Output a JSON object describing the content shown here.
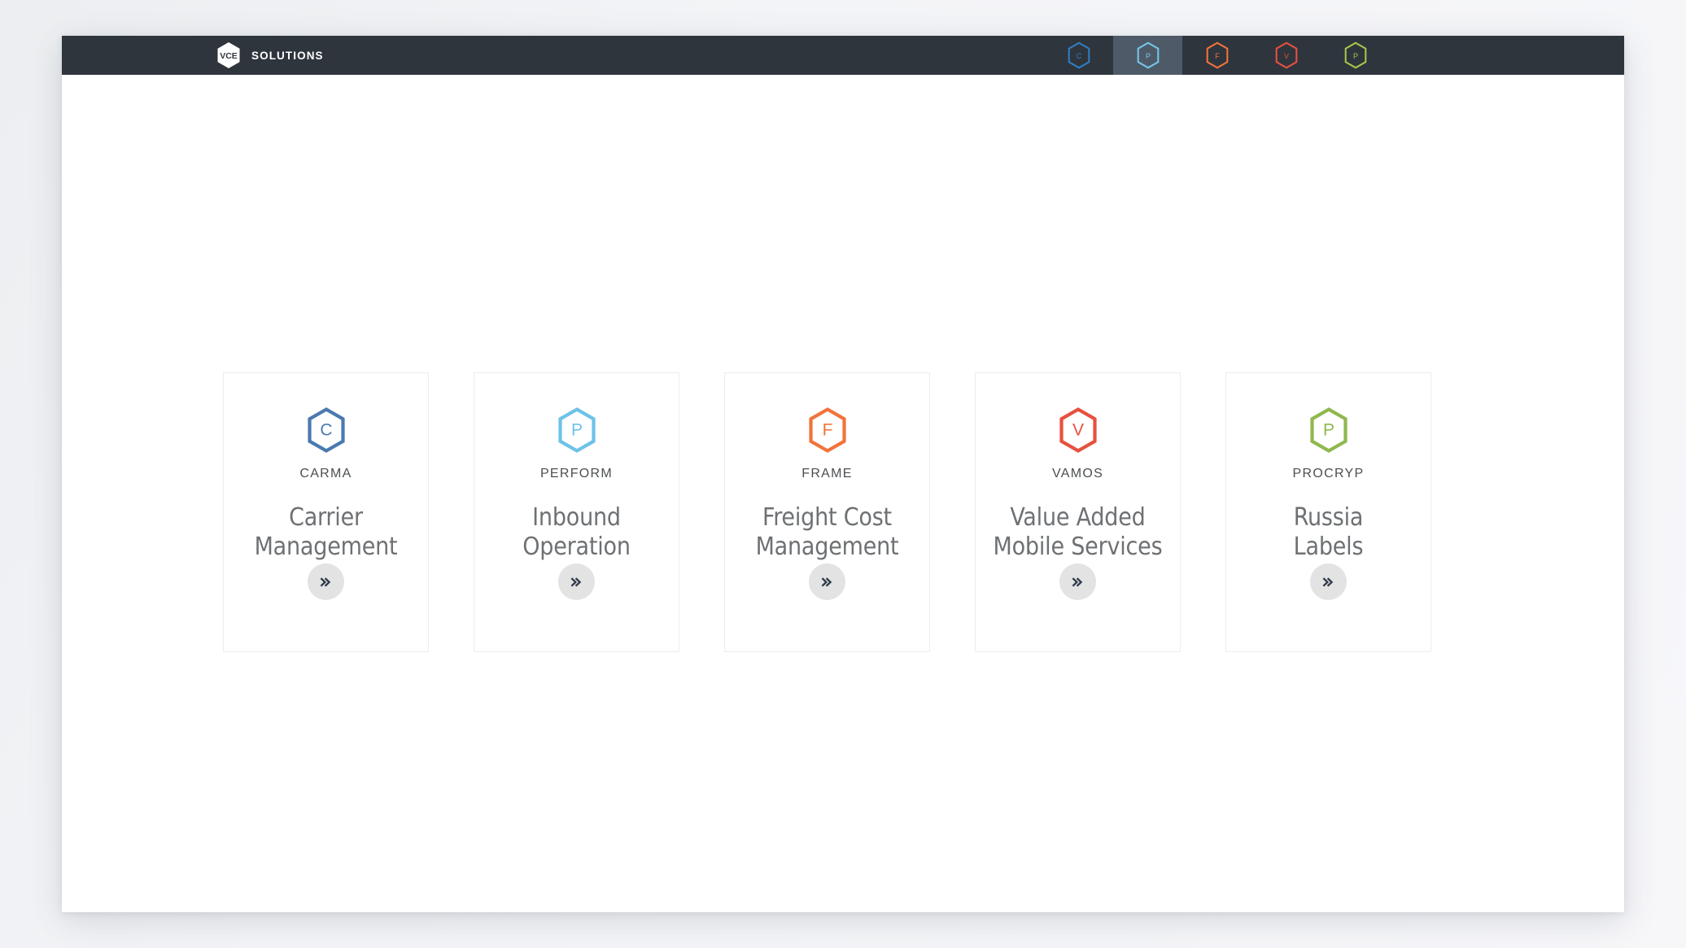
{
  "brand": {
    "logo_icon": "vce-hexagon-logo",
    "logo_text": "VCE",
    "name": "SOLUTIONS"
  },
  "navbar": {
    "background_color": "#2f353d",
    "active_background_color": "#4e5a68",
    "items": [
      {
        "id": "carma",
        "letter": "C",
        "icon": "hexagon-c-icon",
        "color": "#2f7fc4",
        "active": false
      },
      {
        "id": "perform",
        "letter": "P",
        "icon": "hexagon-p-icon",
        "color": "#75c8e8",
        "active": true
      },
      {
        "id": "frame",
        "letter": "F",
        "icon": "hexagon-f-icon",
        "color": "#f2743a",
        "active": false
      },
      {
        "id": "vamos",
        "letter": "V",
        "icon": "hexagon-v-icon",
        "color": "#e8503f",
        "active": false
      },
      {
        "id": "procryp",
        "letter": "P",
        "icon": "hexagon-p-icon",
        "color": "#a9c64a",
        "active": false
      }
    ]
  },
  "cards": [
    {
      "code": "CARMA",
      "title": "Carrier\nManagement",
      "title_line1": "Carrier",
      "title_line2": "Management",
      "letter": "C",
      "icon": "hexagon-c-icon",
      "color": "#4a7ab0",
      "action_icon": "double-chevron-right-icon",
      "action_label": "»"
    },
    {
      "code": "PERFORM",
      "title": "Inbound\nOperation",
      "title_line1": "Inbound",
      "title_line2": "Operation",
      "letter": "P",
      "icon": "hexagon-p-icon",
      "color": "#6dc2e8",
      "action_icon": "double-chevron-right-icon",
      "action_label": "»"
    },
    {
      "code": "FRAME",
      "title": "Freight Cost\nManagement",
      "title_line1": "Freight Cost",
      "title_line2": "Management",
      "letter": "F",
      "icon": "hexagon-f-icon",
      "color": "#f0743c",
      "action_icon": "double-chevron-right-icon",
      "action_label": "»"
    },
    {
      "code": "VAMOS",
      "title": "Value Added\nMobile Services",
      "title_line1": "Value Added",
      "title_line2": "Mobile Services",
      "letter": "V",
      "icon": "hexagon-v-icon",
      "color": "#e8503f",
      "action_icon": "double-chevron-right-icon",
      "action_label": "»"
    },
    {
      "code": "PROCRYP",
      "title": "Russia\nLabels",
      "title_line1": "Russia",
      "title_line2": "Labels",
      "letter": "P",
      "icon": "hexagon-p-icon",
      "color": "#8fb84e",
      "action_icon": "double-chevron-right-icon",
      "action_label": "»"
    }
  ],
  "colors": {
    "page_background": "#ffffff",
    "outer_background": "#f2f3f6",
    "card_border": "#eceded",
    "card_title_text": "#6e7174",
    "card_code_text": "#4b4f52",
    "action_button_bg": "#e3e3e3",
    "action_chevron": "#2f3a4a"
  }
}
